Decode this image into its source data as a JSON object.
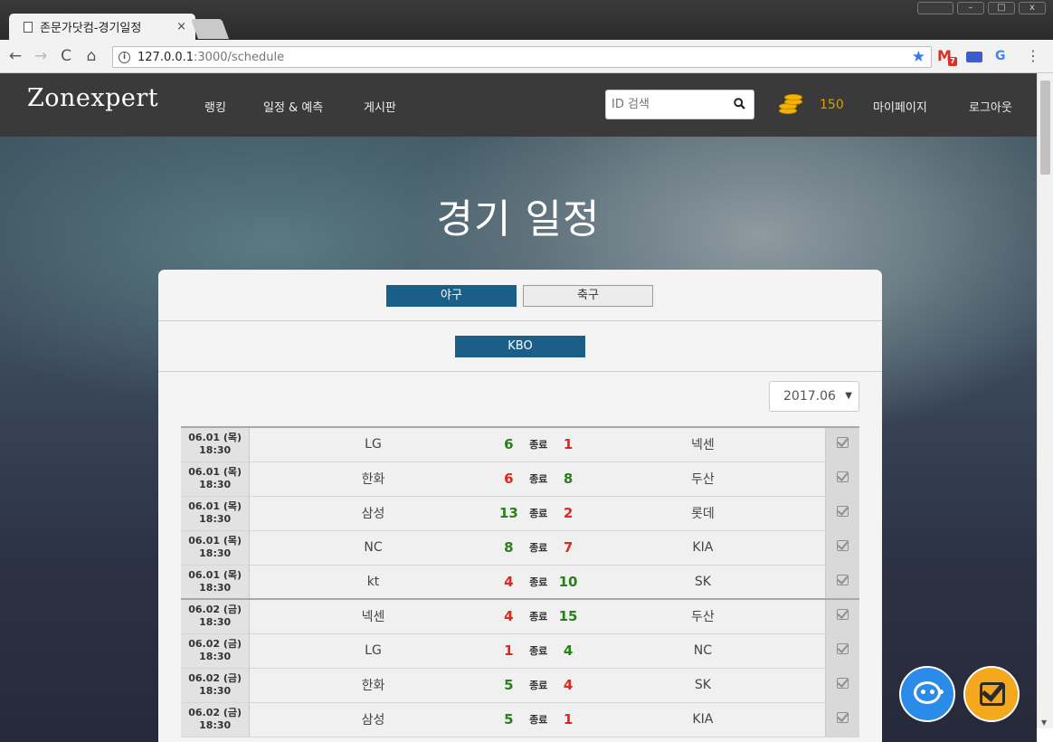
{
  "browser": {
    "tab_title": "존문가닷컴-경기일정",
    "tab_close": "×",
    "url_host": "127.0.0.1",
    "url_rest": ":3000/schedule",
    "ext_gmail_badge": "7"
  },
  "site": {
    "logo": "Zonexpert",
    "nav": {
      "ranking": "랭킹",
      "schedule": "일정 & 예측",
      "board": "게시판"
    },
    "search_placeholder": "ID 검색",
    "coin_count": "150",
    "mypage": "마이페이지",
    "logout": "로그아웃"
  },
  "page": {
    "title": "경기 일정",
    "sports": [
      "야구",
      "축구"
    ],
    "active_sport": "야구",
    "league": "KBO",
    "month": "2017.06",
    "status_label": "종료"
  },
  "games": [
    {
      "date": "06.01 (목)",
      "time": "18:30",
      "home": "LG",
      "home_score": "6",
      "away_score": "1",
      "away": "넥센",
      "day_start": true
    },
    {
      "date": "06.01 (목)",
      "time": "18:30",
      "home": "한화",
      "home_score": "6",
      "away_score": "8",
      "away": "두산"
    },
    {
      "date": "06.01 (목)",
      "time": "18:30",
      "home": "삼성",
      "home_score": "13",
      "away_score": "2",
      "away": "롯데"
    },
    {
      "date": "06.01 (목)",
      "time": "18:30",
      "home": "NC",
      "home_score": "8",
      "away_score": "7",
      "away": "KIA"
    },
    {
      "date": "06.01 (목)",
      "time": "18:30",
      "home": "kt",
      "home_score": "4",
      "away_score": "10",
      "away": "SK"
    },
    {
      "date": "06.02 (금)",
      "time": "18:30",
      "home": "넥센",
      "home_score": "4",
      "away_score": "15",
      "away": "두산",
      "day_start": true
    },
    {
      "date": "06.02 (금)",
      "time": "18:30",
      "home": "LG",
      "home_score": "1",
      "away_score": "4",
      "away": "NC"
    },
    {
      "date": "06.02 (금)",
      "time": "18:30",
      "home": "한화",
      "home_score": "5",
      "away_score": "4",
      "away": "SK"
    },
    {
      "date": "06.02 (금)",
      "time": "18:30",
      "home": "삼성",
      "home_score": "5",
      "away_score": "1",
      "away": "KIA"
    }
  ],
  "colors": {
    "win": "#2a7f1b",
    "lose": "#e0261f",
    "accent": "#1b5f88",
    "coin": "#d6a200"
  }
}
